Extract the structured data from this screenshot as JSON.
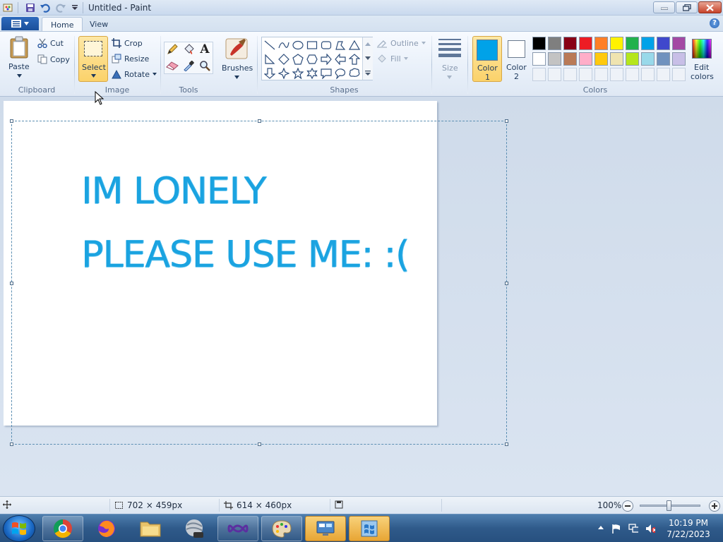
{
  "window": {
    "title": "Untitled - Paint"
  },
  "tabs": [
    {
      "label": "Home",
      "active": true
    },
    {
      "label": "View",
      "active": false
    }
  ],
  "clipboard": {
    "group_label": "Clipboard",
    "paste_label": "Paste",
    "cut_label": "Cut",
    "copy_label": "Copy"
  },
  "image": {
    "group_label": "Image",
    "select_label": "Select",
    "crop_label": "Crop",
    "resize_label": "Resize",
    "rotate_label": "Rotate"
  },
  "tools": {
    "group_label": "Tools",
    "brushes_label": "Brushes"
  },
  "shapes": {
    "group_label": "Shapes",
    "outline_label": "Outline",
    "fill_label": "Fill",
    "size_label": "Size"
  },
  "colors": {
    "group_label": "Colors",
    "color1_label_line1": "Color",
    "color1_label_line2": "1",
    "color2_label_line1": "Color",
    "color2_label_line2": "2",
    "edit_colors_line1": "Edit",
    "edit_colors_line2": "colors",
    "color1_value": "#00a2e8",
    "color2_value": "#ffffff",
    "palette_row1": [
      "#000000",
      "#7f7f7f",
      "#880015",
      "#ed1c24",
      "#ff7f27",
      "#fff200",
      "#22b14c",
      "#00a2e8",
      "#3f48cc",
      "#a349a4"
    ],
    "palette_row2": [
      "#ffffff",
      "#c3c3c3",
      "#b97a57",
      "#ffaec9",
      "#ffc90e",
      "#efe4b0",
      "#b5e61d",
      "#99d9ea",
      "#7092be",
      "#c8bfe7"
    ]
  },
  "canvas": {
    "line1": "IM LONELY",
    "line2": "PLEASE USE ME: :("
  },
  "status": {
    "selection_size": "702 × 459px",
    "canvas_size": "614 × 460px",
    "zoom": "100%"
  },
  "taskbar": {
    "time": "10:19 PM",
    "date": "7/22/2023"
  }
}
